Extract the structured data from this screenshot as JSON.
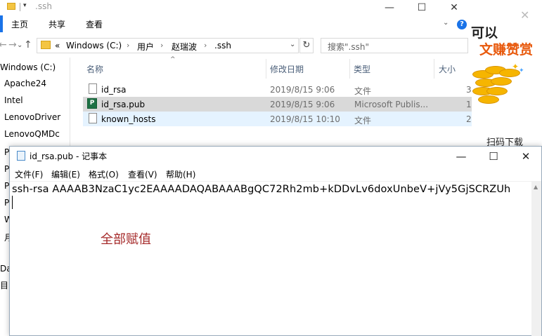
{
  "explorer": {
    "title": ".ssh",
    "window_min": "—",
    "window_max": "☐",
    "window_close": "✕",
    "ribbon_tabs": [
      "主页",
      "共享",
      "查看"
    ],
    "help": "?",
    "nav": {
      "back": "←",
      "forward": "→",
      "dropdown": "⌄",
      "up": "↑"
    },
    "address": {
      "overflow": "«",
      "segments": [
        "Windows (C:)",
        "用户",
        "赵瑞波",
        ".ssh"
      ],
      "separator": "›",
      "dropdown": "⌄",
      "refresh": "↻"
    },
    "search_placeholder": "搜索\".ssh\"",
    "sidebar": {
      "top_item": "Windows (C:)",
      "items": [
        "Apache24",
        "Intel",
        "LenovoDriver",
        "LenovoQMDc"
      ],
      "partial_items": [
        "P",
        "P",
        "P",
        "P",
        "W",
        "月",
        "Da",
        "目"
      ]
    },
    "columns": [
      "名称",
      "修改日期",
      "类型",
      "大小"
    ],
    "sort_arrow": "^",
    "files": [
      {
        "name": "id_rsa",
        "date": "2019/8/15 9:06",
        "type": "文件",
        "size": "3"
      },
      {
        "name": "id_rsa.pub",
        "date": "2019/8/15 9:06",
        "type": "Microsoft Publis...",
        "size": "1"
      },
      {
        "name": "known_hosts",
        "date": "2019/8/15 10:10",
        "type": "文件",
        "size": "2"
      }
    ],
    "pub_icon_letter": "P"
  },
  "ad": {
    "close": "✕",
    "line1": "可以",
    "line2": "文赚赞赏",
    "footer": "扫码下载"
  },
  "notepad": {
    "title": "id_rsa.pub - 记事本",
    "min": "—",
    "max": "☐",
    "close": "✕",
    "menu": [
      "文件(F)",
      "编辑(E)",
      "格式(O)",
      "查看(V)",
      "帮助(H)"
    ],
    "content": "ssh-rsa AAAAB3NzaC1yc2EAAAADAQABAAABgQC72Rh2mb+kDDvLv6doxUnbeV+jVy5GjSCRZUh",
    "scroll_up": "▲"
  },
  "annotation": "全部赋值",
  "colors": {
    "accent": "#1a73e8",
    "annotation": "#a52a2a",
    "ad_orange": "#e8590c",
    "coin": "#f6b500"
  }
}
